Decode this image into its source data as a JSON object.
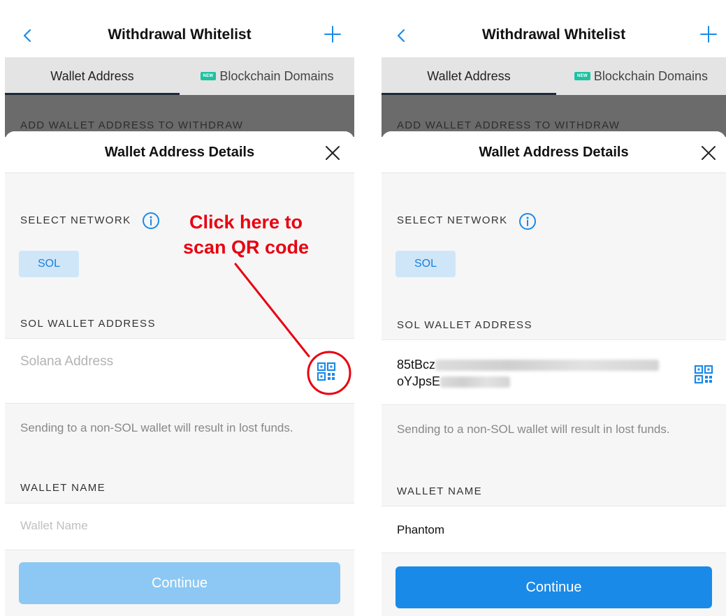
{
  "left": {
    "nav": {
      "title": "Withdrawal Whitelist"
    },
    "tabs": {
      "wallet_address": "Wallet Address",
      "new_badge": "NEW",
      "blockchain_domains": "Blockchain Domains"
    },
    "overlay_heading": "ADD WALLET ADDRESS TO WITHDRAW",
    "sheet": {
      "title": "Wallet Address Details",
      "select_network_label": "SELECT NETWORK",
      "network_chip": "SOL",
      "address_label": "SOL WALLET ADDRESS",
      "address_placeholder": "Solana Address",
      "warning": "Sending to a non-SOL wallet will result in lost funds.",
      "wallet_name_label": "WALLET NAME",
      "wallet_name_placeholder": "Wallet Name",
      "continue_label": "Continue"
    },
    "annotation": {
      "line1": "Click here to",
      "line2": "scan QR code",
      "color": "#e8000f"
    }
  },
  "right": {
    "nav": {
      "title": "Withdrawal Whitelist"
    },
    "tabs": {
      "wallet_address": "Wallet Address",
      "new_badge": "NEW",
      "blockchain_domains": "Blockchain Domains"
    },
    "overlay_heading": "ADD WALLET ADDRESS TO WITHDRAW",
    "sheet": {
      "title": "Wallet Address Details",
      "select_network_label": "SELECT NETWORK",
      "network_chip": "SOL",
      "address_label": "SOL WALLET ADDRESS",
      "address_line1": "85tBcz",
      "address_line2": "oYJpsE",
      "warning": "Sending to a non-SOL wallet will result in lost funds.",
      "wallet_name_label": "WALLET NAME",
      "wallet_name_value": "Phantom",
      "continue_label": "Continue"
    }
  },
  "colors": {
    "accent": "#1a8ae8",
    "accent_disabled": "#8cc8f3",
    "chip_bg": "#cfe6f9",
    "badge": "#1fc1a0"
  }
}
